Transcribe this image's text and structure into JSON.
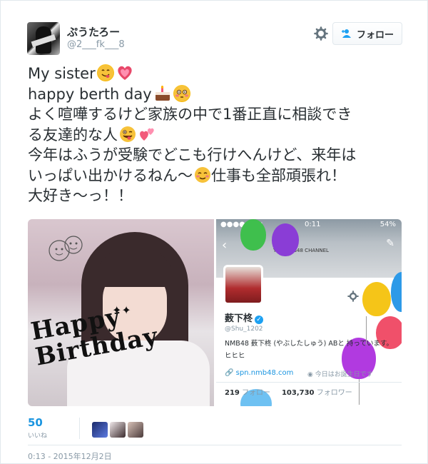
{
  "author": {
    "name": "ぷうたろー",
    "handle": "@2___fk___8"
  },
  "follow_button": {
    "label": "フォロー"
  },
  "tweet": {
    "lines": [
      "My sister",
      "happy berth day",
      "よく喧嘩するけど家族の中で1番正直に相談でき",
      "る友達的な人",
      "今年はふうが受験でどこも行けへんけど、来年は",
      "いっぱい出かけるねん〜",
      "仕事も全部頑張れ！",
      "大好き〜っ！！"
    ]
  },
  "media": {
    "left_image": {
      "caption": "Happy Birthday"
    },
    "right_image": {
      "status_carrier": "●●●●○ au",
      "status_time": "0:11",
      "status_battery": "54%",
      "channel_label": "YNN NMB48 CHANNEL",
      "profile_name": "薮下柊",
      "profile_handle": "@Shu_1202",
      "profile_bio": "NMB48 薮下柊 (やぶしたしゅう) ABと   持っています。ヒヒヒ",
      "profile_link": "spn.nmb48.com",
      "profile_birthday": "今日はお誕生日です",
      "following_count": "219",
      "following_label": "フォロー",
      "followers_count": "103,730",
      "followers_label": "フォロワー"
    }
  },
  "stats": {
    "likes_count": "50",
    "likes_label": "いいね"
  },
  "timestamp": "0:13 - 2015年12月2日",
  "colors": {
    "link_blue": "#1b95e0",
    "meta_gray": "#8899a6",
    "text": "#292f33"
  }
}
